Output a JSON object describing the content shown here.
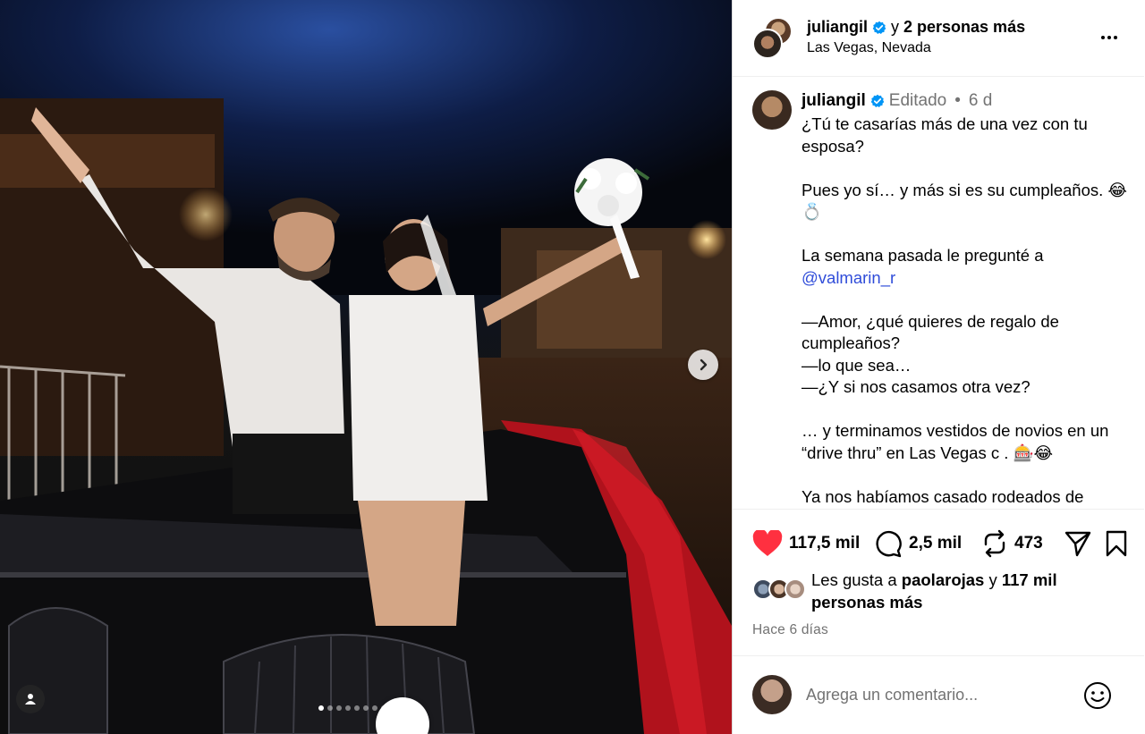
{
  "post": {
    "author": "juliangil",
    "coauthors_conjunction": "y",
    "coauthors_text": "2 personas más",
    "location": "Las Vegas, Nevada"
  },
  "caption": {
    "username": "juliangil",
    "edited_label": "Editado",
    "separator": "•",
    "time": "6 d",
    "lines": {
      "l1": "¿Tú te casarías más de una vez con tu esposa?",
      "l2": "Pues yo sí… y más si es su cumpleaños. 😂💍",
      "l3": "La semana pasada le pregunté a",
      "mention": "@valmarin_r",
      "l4": "—Amor, ¿qué quieres de regalo de cumpleaños?",
      "l5": "—lo que sea…",
      "l6": "—¿Y si nos casamos otra vez?",
      "l7": "… y terminamos vestidos de novios en un “drive thru” en Las Vegas c . 🎰😂",
      "l8": "Ya nos habíamos casado rodeados de"
    }
  },
  "actions": {
    "likes": "117,5 mil",
    "comments": "2,5 mil",
    "reposts": "473"
  },
  "likes_summary": {
    "prefix": "Les gusta a",
    "user": "paolarojas",
    "conj": "y",
    "rest": "117 mil personas más"
  },
  "posted_ago": "Hace 6 días",
  "comment": {
    "placeholder": "Agrega un comentario..."
  },
  "carousel": {
    "total": 11,
    "active": 1
  },
  "colors": {
    "verified": "#0095f6",
    "like_red": "#ff3040",
    "link_blue": "#2f4cd9",
    "muted": "#737373"
  },
  "icons": [
    "verified-badge-icon",
    "more-options-icon",
    "heart-icon",
    "comment-icon",
    "repost-icon",
    "share-icon",
    "save-icon",
    "emoji-icon",
    "next-arrow-icon",
    "tagged-user-icon"
  ]
}
